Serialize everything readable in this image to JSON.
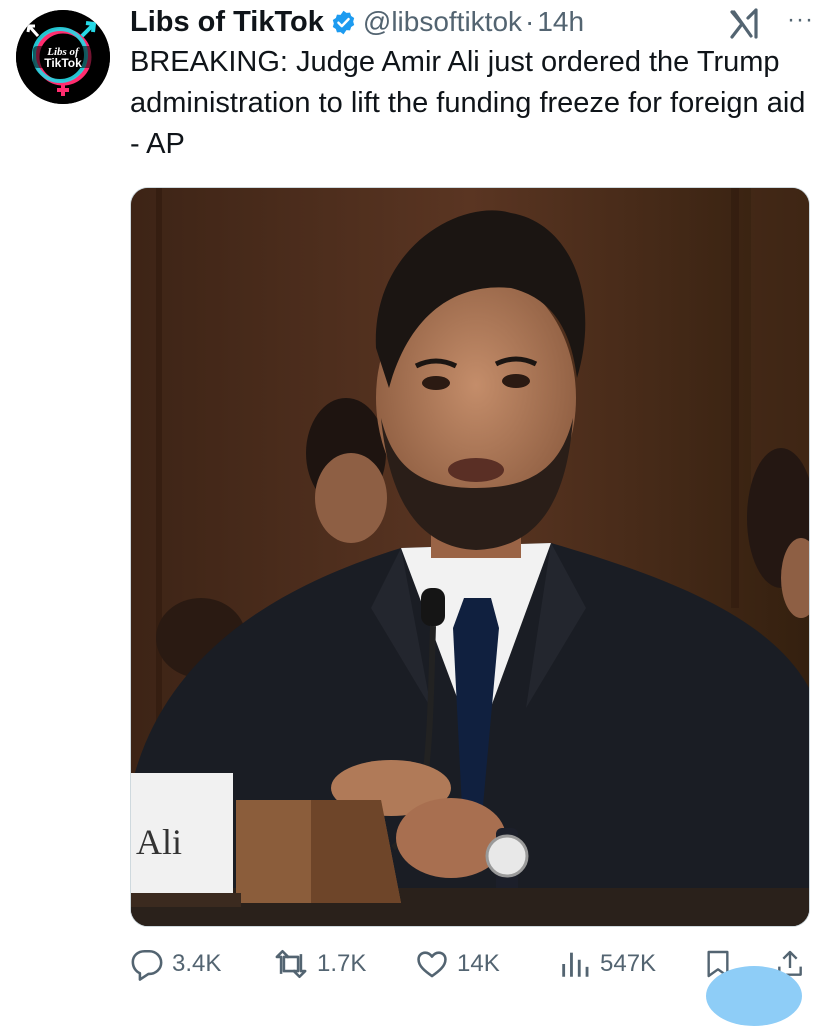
{
  "tweet": {
    "author_name": "Libs of TikTok",
    "author_handle": "@libsoftiktok",
    "separator": "·",
    "time": "14h",
    "text": "BREAKING: Judge Amir Ali just ordered the Trump administration to lift the funding freeze for foreign aid - AP",
    "avatar_text_line1": "Libs of",
    "avatar_text_line2": "TikTok"
  },
  "media": {
    "nameplate_text": "Ali"
  },
  "actions": {
    "replies": "3.4K",
    "reposts": "1.7K",
    "likes": "14K",
    "views": "547K"
  },
  "icons": {
    "verified": "verified-badge-icon",
    "grok": "grok-icon",
    "more": "more-icon",
    "reply": "reply-icon",
    "repost": "repost-icon",
    "like": "like-icon",
    "views": "views-icon",
    "bookmark": "bookmark-icon",
    "share": "share-icon"
  },
  "colors": {
    "verified_blue": "#1d9bf0",
    "secondary_text": "#536471",
    "primary_text": "#0f1419"
  }
}
